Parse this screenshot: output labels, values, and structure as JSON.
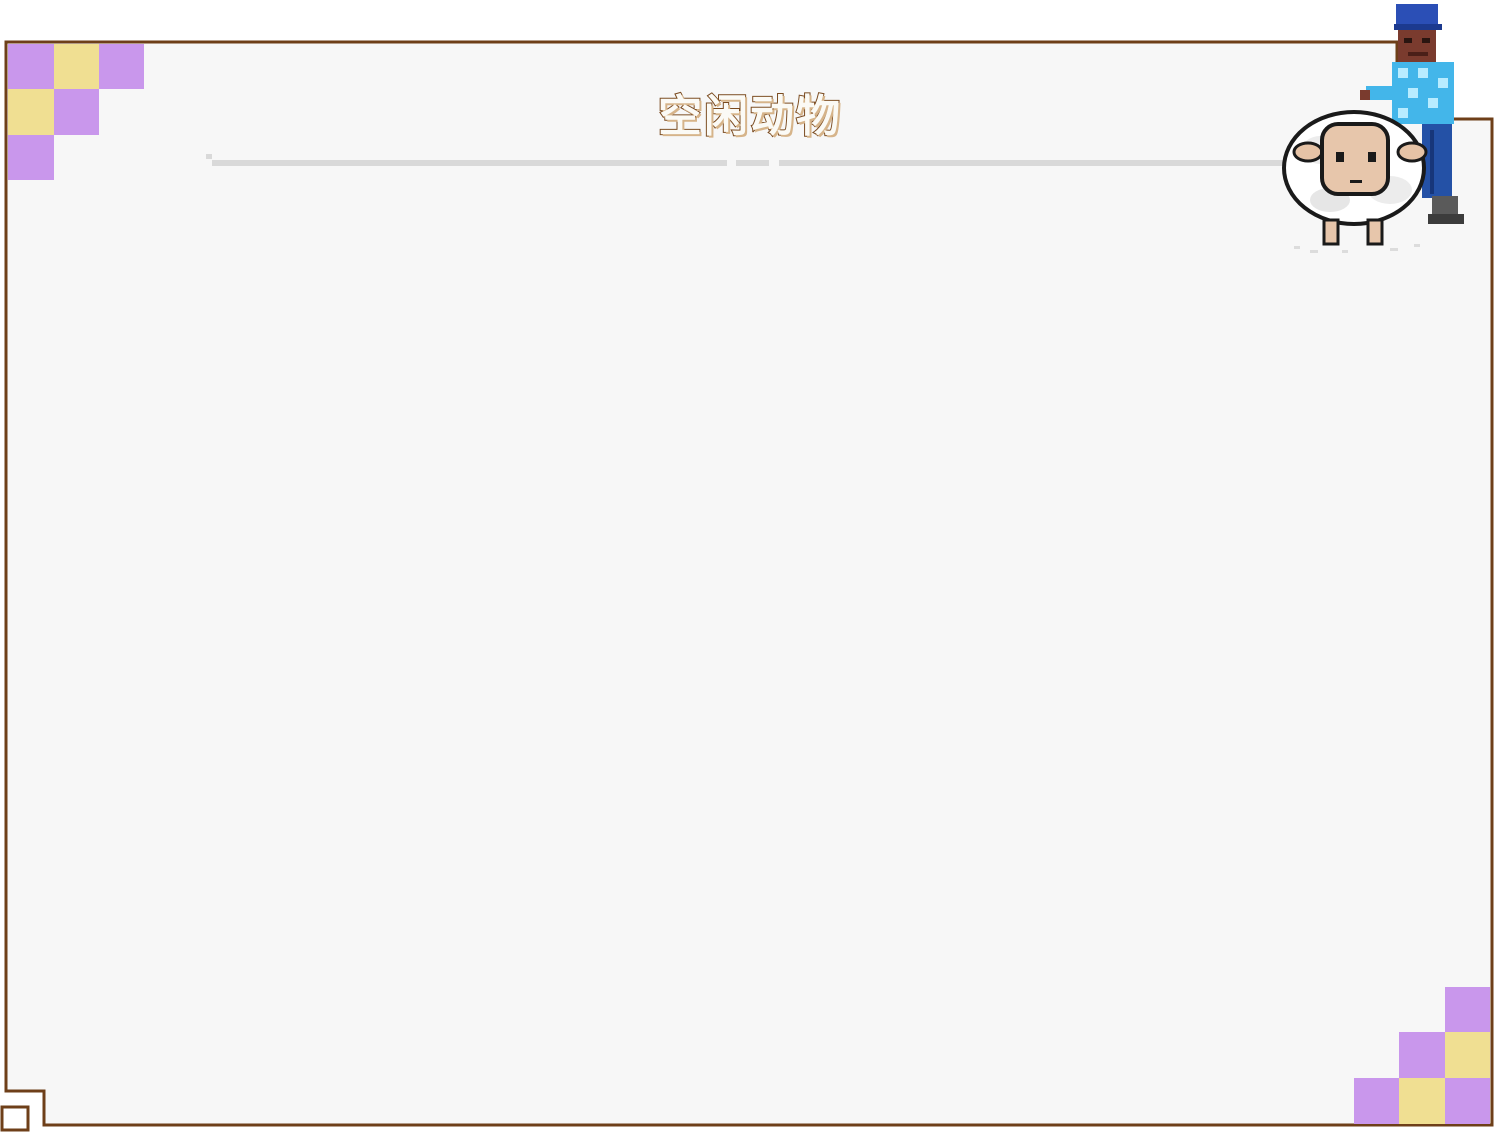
{
  "dialog": {
    "title": "空闲动物"
  },
  "colors": {
    "border": "#6e3f19",
    "panel_bg": "#f7f7f7",
    "checker_purple": "#c997ec",
    "checker_yellow": "#f0df92",
    "divider": "#d9d9d9"
  },
  "icons": {
    "mascot": "farmer-with-sheep-icon",
    "corner_top_left": "checker-corner-icon",
    "corner_bottom_right": "checker-corner-icon",
    "corner_bottom_left": "frame-notch-icon"
  }
}
